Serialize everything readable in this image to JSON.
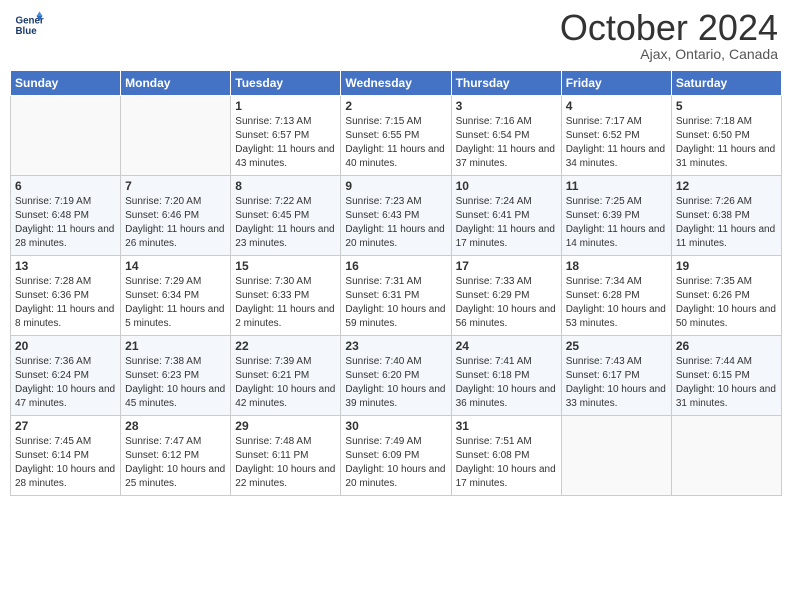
{
  "header": {
    "logo_line1": "General",
    "logo_line2": "Blue",
    "month_title": "October 2024",
    "location": "Ajax, Ontario, Canada"
  },
  "weekdays": [
    "Sunday",
    "Monday",
    "Tuesday",
    "Wednesday",
    "Thursday",
    "Friday",
    "Saturday"
  ],
  "weeks": [
    [
      {
        "day": "",
        "sunrise": "",
        "sunset": "",
        "daylight": ""
      },
      {
        "day": "",
        "sunrise": "",
        "sunset": "",
        "daylight": ""
      },
      {
        "day": "1",
        "sunrise": "Sunrise: 7:13 AM",
        "sunset": "Sunset: 6:57 PM",
        "daylight": "Daylight: 11 hours and 43 minutes."
      },
      {
        "day": "2",
        "sunrise": "Sunrise: 7:15 AM",
        "sunset": "Sunset: 6:55 PM",
        "daylight": "Daylight: 11 hours and 40 minutes."
      },
      {
        "day": "3",
        "sunrise": "Sunrise: 7:16 AM",
        "sunset": "Sunset: 6:54 PM",
        "daylight": "Daylight: 11 hours and 37 minutes."
      },
      {
        "day": "4",
        "sunrise": "Sunrise: 7:17 AM",
        "sunset": "Sunset: 6:52 PM",
        "daylight": "Daylight: 11 hours and 34 minutes."
      },
      {
        "day": "5",
        "sunrise": "Sunrise: 7:18 AM",
        "sunset": "Sunset: 6:50 PM",
        "daylight": "Daylight: 11 hours and 31 minutes."
      }
    ],
    [
      {
        "day": "6",
        "sunrise": "Sunrise: 7:19 AM",
        "sunset": "Sunset: 6:48 PM",
        "daylight": "Daylight: 11 hours and 28 minutes."
      },
      {
        "day": "7",
        "sunrise": "Sunrise: 7:20 AM",
        "sunset": "Sunset: 6:46 PM",
        "daylight": "Daylight: 11 hours and 26 minutes."
      },
      {
        "day": "8",
        "sunrise": "Sunrise: 7:22 AM",
        "sunset": "Sunset: 6:45 PM",
        "daylight": "Daylight: 11 hours and 23 minutes."
      },
      {
        "day": "9",
        "sunrise": "Sunrise: 7:23 AM",
        "sunset": "Sunset: 6:43 PM",
        "daylight": "Daylight: 11 hours and 20 minutes."
      },
      {
        "day": "10",
        "sunrise": "Sunrise: 7:24 AM",
        "sunset": "Sunset: 6:41 PM",
        "daylight": "Daylight: 11 hours and 17 minutes."
      },
      {
        "day": "11",
        "sunrise": "Sunrise: 7:25 AM",
        "sunset": "Sunset: 6:39 PM",
        "daylight": "Daylight: 11 hours and 14 minutes."
      },
      {
        "day": "12",
        "sunrise": "Sunrise: 7:26 AM",
        "sunset": "Sunset: 6:38 PM",
        "daylight": "Daylight: 11 hours and 11 minutes."
      }
    ],
    [
      {
        "day": "13",
        "sunrise": "Sunrise: 7:28 AM",
        "sunset": "Sunset: 6:36 PM",
        "daylight": "Daylight: 11 hours and 8 minutes."
      },
      {
        "day": "14",
        "sunrise": "Sunrise: 7:29 AM",
        "sunset": "Sunset: 6:34 PM",
        "daylight": "Daylight: 11 hours and 5 minutes."
      },
      {
        "day": "15",
        "sunrise": "Sunrise: 7:30 AM",
        "sunset": "Sunset: 6:33 PM",
        "daylight": "Daylight: 11 hours and 2 minutes."
      },
      {
        "day": "16",
        "sunrise": "Sunrise: 7:31 AM",
        "sunset": "Sunset: 6:31 PM",
        "daylight": "Daylight: 10 hours and 59 minutes."
      },
      {
        "day": "17",
        "sunrise": "Sunrise: 7:33 AM",
        "sunset": "Sunset: 6:29 PM",
        "daylight": "Daylight: 10 hours and 56 minutes."
      },
      {
        "day": "18",
        "sunrise": "Sunrise: 7:34 AM",
        "sunset": "Sunset: 6:28 PM",
        "daylight": "Daylight: 10 hours and 53 minutes."
      },
      {
        "day": "19",
        "sunrise": "Sunrise: 7:35 AM",
        "sunset": "Sunset: 6:26 PM",
        "daylight": "Daylight: 10 hours and 50 minutes."
      }
    ],
    [
      {
        "day": "20",
        "sunrise": "Sunrise: 7:36 AM",
        "sunset": "Sunset: 6:24 PM",
        "daylight": "Daylight: 10 hours and 47 minutes."
      },
      {
        "day": "21",
        "sunrise": "Sunrise: 7:38 AM",
        "sunset": "Sunset: 6:23 PM",
        "daylight": "Daylight: 10 hours and 45 minutes."
      },
      {
        "day": "22",
        "sunrise": "Sunrise: 7:39 AM",
        "sunset": "Sunset: 6:21 PM",
        "daylight": "Daylight: 10 hours and 42 minutes."
      },
      {
        "day": "23",
        "sunrise": "Sunrise: 7:40 AM",
        "sunset": "Sunset: 6:20 PM",
        "daylight": "Daylight: 10 hours and 39 minutes."
      },
      {
        "day": "24",
        "sunrise": "Sunrise: 7:41 AM",
        "sunset": "Sunset: 6:18 PM",
        "daylight": "Daylight: 10 hours and 36 minutes."
      },
      {
        "day": "25",
        "sunrise": "Sunrise: 7:43 AM",
        "sunset": "Sunset: 6:17 PM",
        "daylight": "Daylight: 10 hours and 33 minutes."
      },
      {
        "day": "26",
        "sunrise": "Sunrise: 7:44 AM",
        "sunset": "Sunset: 6:15 PM",
        "daylight": "Daylight: 10 hours and 31 minutes."
      }
    ],
    [
      {
        "day": "27",
        "sunrise": "Sunrise: 7:45 AM",
        "sunset": "Sunset: 6:14 PM",
        "daylight": "Daylight: 10 hours and 28 minutes."
      },
      {
        "day": "28",
        "sunrise": "Sunrise: 7:47 AM",
        "sunset": "Sunset: 6:12 PM",
        "daylight": "Daylight: 10 hours and 25 minutes."
      },
      {
        "day": "29",
        "sunrise": "Sunrise: 7:48 AM",
        "sunset": "Sunset: 6:11 PM",
        "daylight": "Daylight: 10 hours and 22 minutes."
      },
      {
        "day": "30",
        "sunrise": "Sunrise: 7:49 AM",
        "sunset": "Sunset: 6:09 PM",
        "daylight": "Daylight: 10 hours and 20 minutes."
      },
      {
        "day": "31",
        "sunrise": "Sunrise: 7:51 AM",
        "sunset": "Sunset: 6:08 PM",
        "daylight": "Daylight: 10 hours and 17 minutes."
      },
      {
        "day": "",
        "sunrise": "",
        "sunset": "",
        "daylight": ""
      },
      {
        "day": "",
        "sunrise": "",
        "sunset": "",
        "daylight": ""
      }
    ]
  ]
}
